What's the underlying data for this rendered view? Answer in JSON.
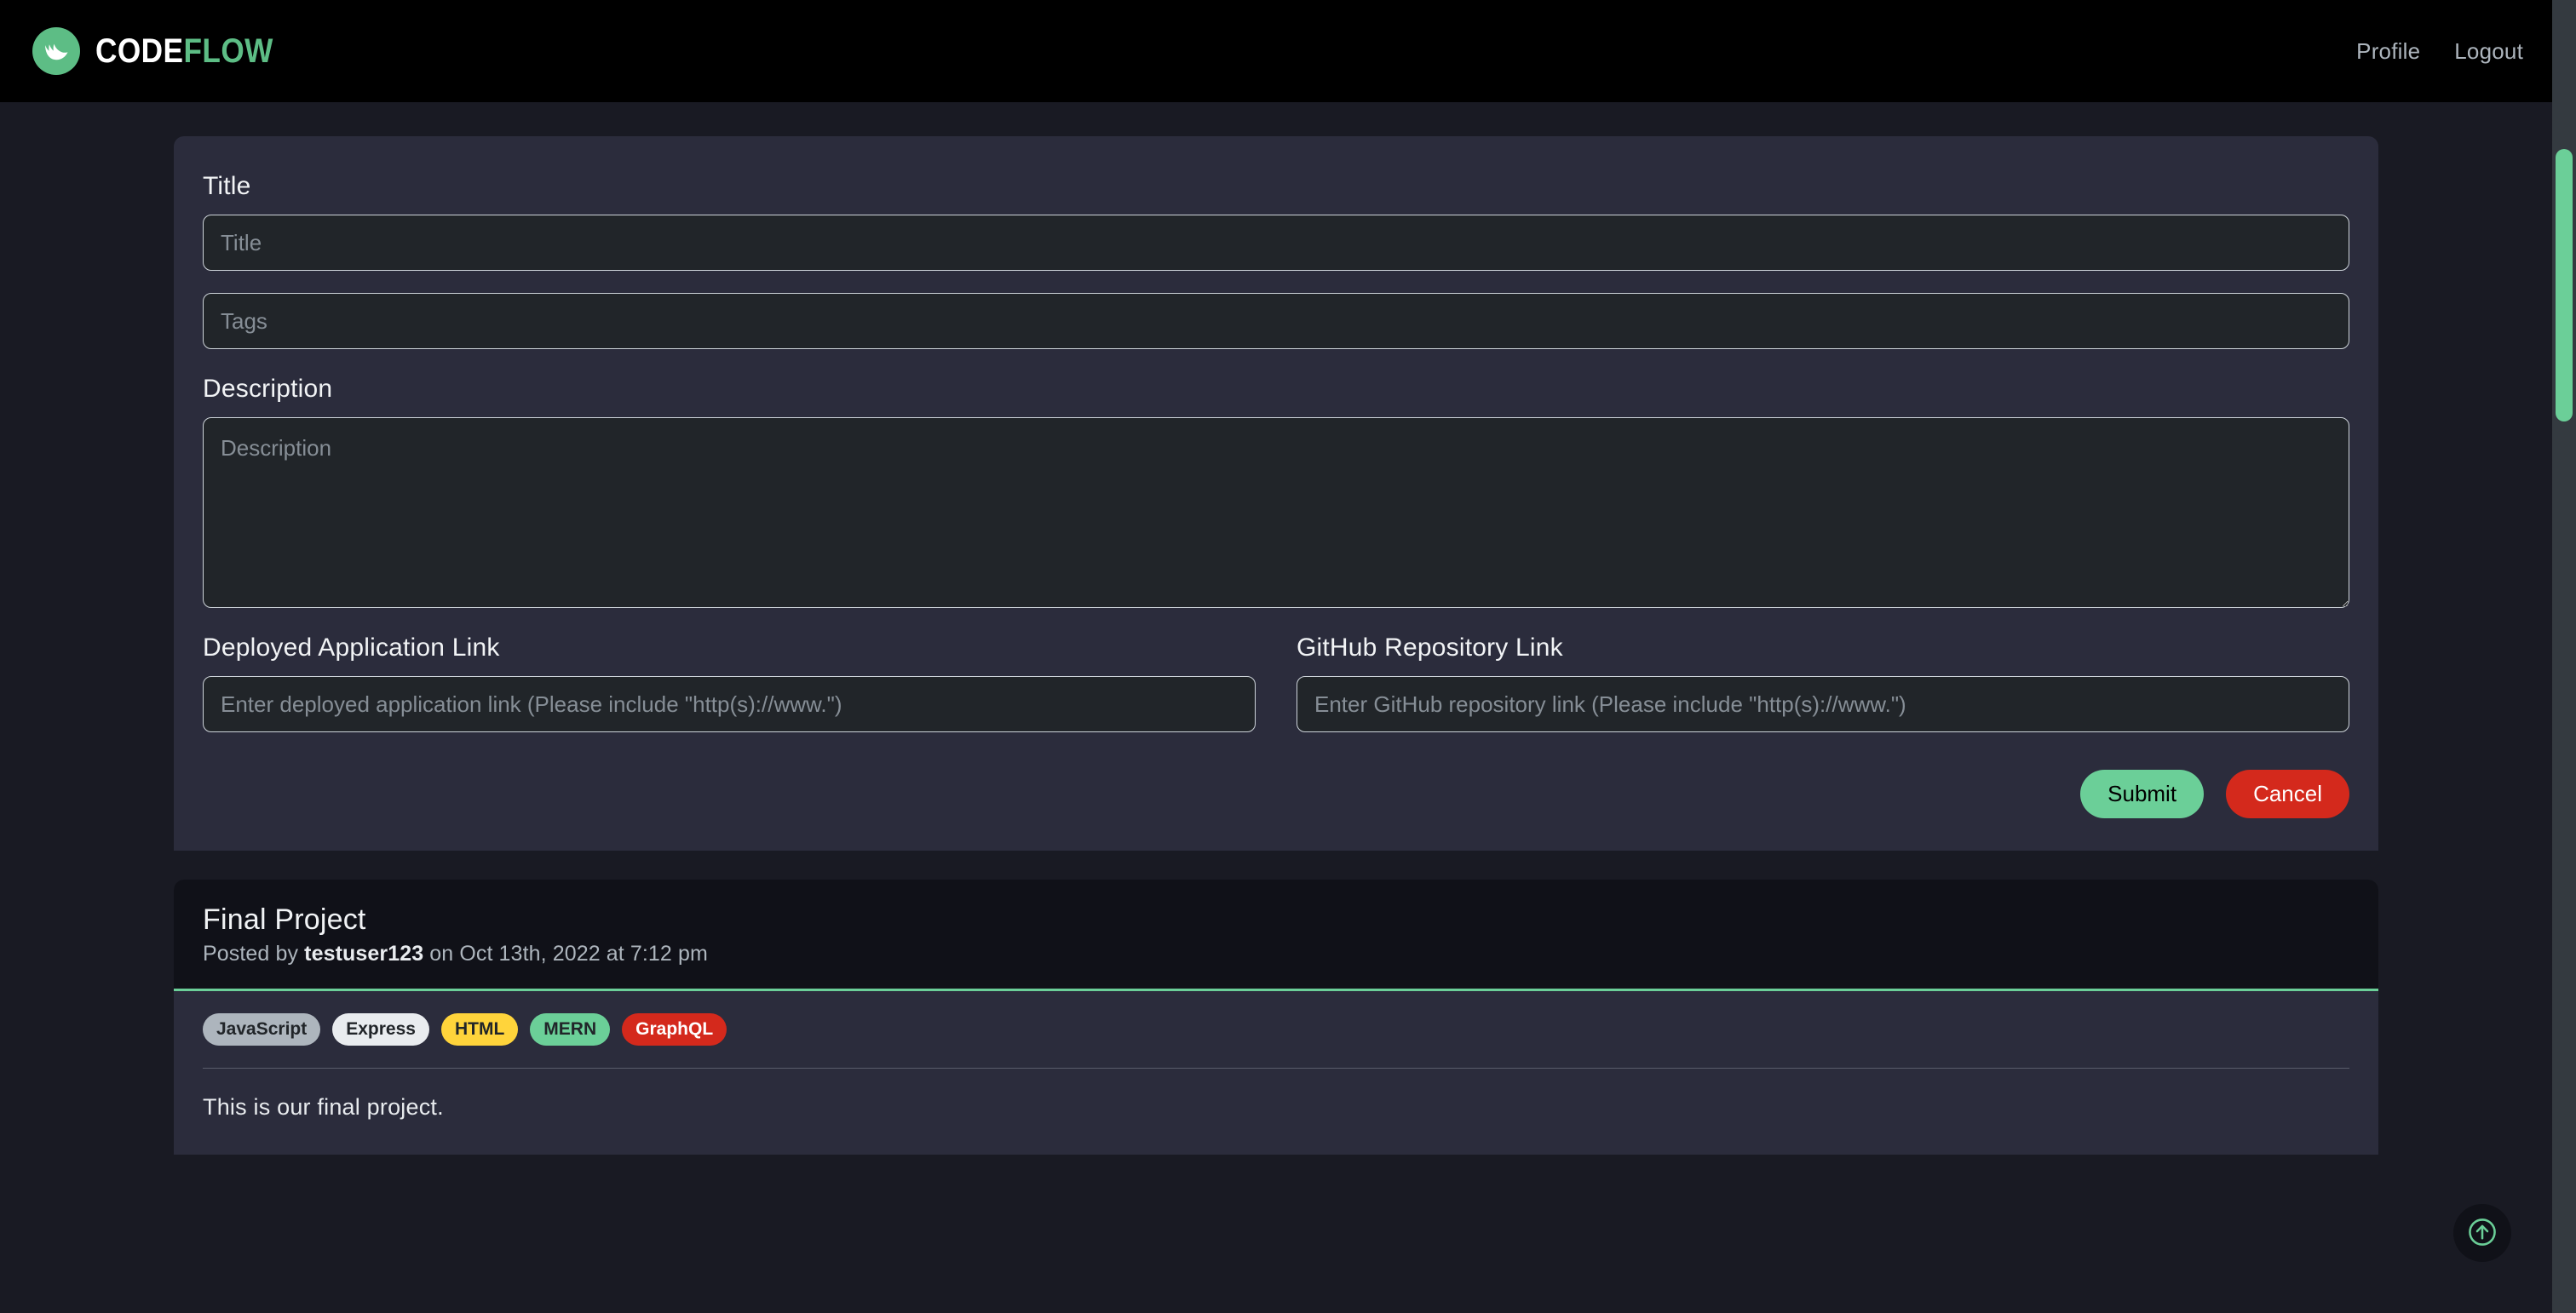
{
  "navbar": {
    "brand": {
      "code": "CODE",
      "flow": "FLOW",
      "mark_icon": "flame-logo-icon"
    },
    "links": [
      {
        "label": "Profile",
        "name": "nav-link-profile"
      },
      {
        "label": "Logout",
        "name": "nav-link-logout"
      }
    ]
  },
  "form": {
    "title_label": "Title",
    "title_placeholder": "Title",
    "title_value": "",
    "tags_placeholder": "Tags",
    "tags_value": "",
    "description_label": "Description",
    "description_placeholder": "Description",
    "description_value": "",
    "deployed_label": "Deployed Application Link",
    "deployed_placeholder": "Enter deployed application link (Please include \"http(s)://www.\")",
    "deployed_value": "",
    "github_label": "GitHub Repository Link",
    "github_placeholder": "Enter GitHub repository link (Please include \"http(s)://www.\")",
    "github_value": "",
    "submit_label": "Submit",
    "cancel_label": "Cancel"
  },
  "project": {
    "title": "Final Project",
    "posted_prefix": "Posted by",
    "author": "testuser123",
    "posted_suffix": "on Oct 13th, 2022 at 7:12 pm",
    "tags": [
      {
        "label": "JavaScript",
        "bg": "#adb5bd",
        "fg": "#212529"
      },
      {
        "label": "Express",
        "bg": "#e9ecef",
        "fg": "#212529"
      },
      {
        "label": "HTML",
        "bg": "#ffd43b",
        "fg": "#212529"
      },
      {
        "label": "MERN",
        "bg": "#6bcf98",
        "fg": "#212529"
      },
      {
        "label": "GraphQL",
        "bg": "#d4291c",
        "fg": "#ffffff"
      }
    ],
    "description": "This is our final project."
  },
  "scroll_top": {
    "icon": "arrow-up-circle-icon",
    "label": "Scroll to top"
  },
  "colors": {
    "accent_green": "#6bcf98",
    "danger_red": "#d4291c",
    "page_bg": "#191a23",
    "card_bg": "#2b2c3c",
    "input_bg": "#212529",
    "navbar_bg": "#000000"
  }
}
